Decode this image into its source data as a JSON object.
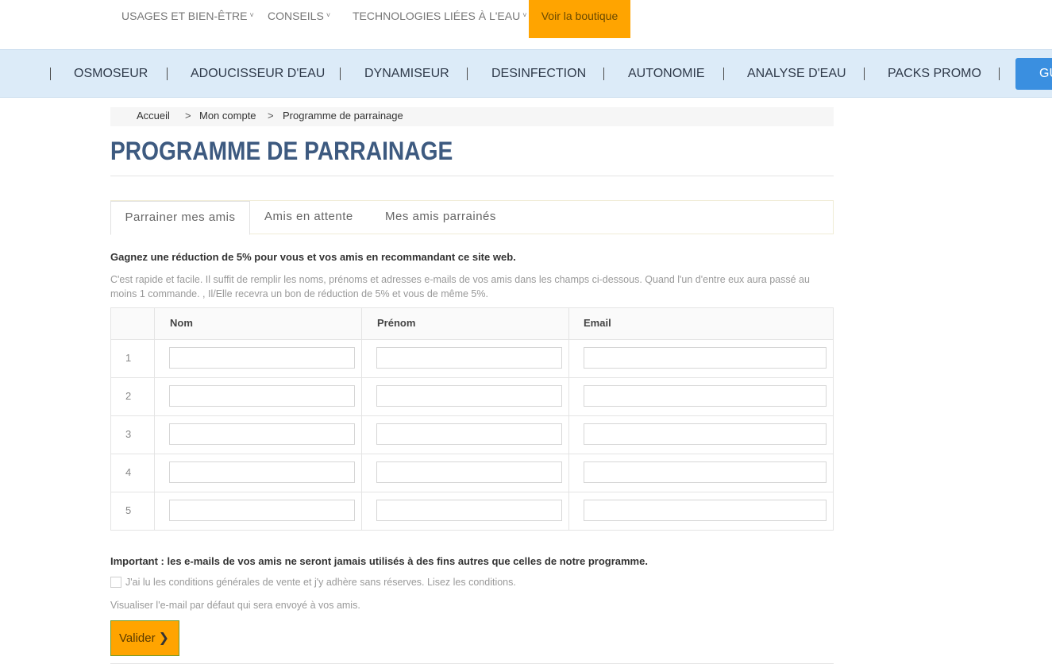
{
  "top_nav": {
    "items": [
      {
        "label": "USAGES ET BIEN-ÊTRE"
      },
      {
        "label": "CONSEILS"
      },
      {
        "label": "TECHNOLOGIES LIÉES À L'EAU"
      }
    ],
    "shop_button": "Voir la boutique",
    "chevron_icon": "chevron-down-icon"
  },
  "category_bar": {
    "items": [
      "OSMOSEUR",
      "ADOUCISSEUR D'EAU",
      "DYNAMISEUR",
      "DESINFECTION",
      "AUTONOMIE",
      "ANALYSE D'EAU",
      "PACKS PROMO"
    ],
    "cut_button": "GU"
  },
  "breadcrumb": {
    "items": [
      "Accueil",
      "Mon compte",
      "Programme de parrainage"
    ],
    "separator": ">"
  },
  "page_title": "PROGRAMME DE PARRAINAGE",
  "tabs": [
    {
      "label": "Parrainer mes amis",
      "active": true
    },
    {
      "label": "Amis en attente",
      "active": false
    },
    {
      "label": "Mes amis parrainés",
      "active": false
    }
  ],
  "intro": {
    "headline": "Gagnez une réduction de 5% pour vous et vos amis en recommandant ce site web.",
    "text": "C'est rapide et facile. Il suffit de remplir les noms, prénoms et adresses e-mails de vos amis dans les champs ci-dessous. Quand l'un d'entre eux aura passé au moins 1 commande. , Il/Elle recevra un bon de réduction de 5% et vous de même 5%."
  },
  "friends_table": {
    "columns": [
      "",
      "Nom",
      "Prénom",
      "Email"
    ],
    "rows": [
      {
        "num": "1",
        "nom": "",
        "prenom": "",
        "email": ""
      },
      {
        "num": "2",
        "nom": "",
        "prenom": "",
        "email": ""
      },
      {
        "num": "3",
        "nom": "",
        "prenom": "",
        "email": ""
      },
      {
        "num": "4",
        "nom": "",
        "prenom": "",
        "email": ""
      },
      {
        "num": "5",
        "nom": "",
        "prenom": "",
        "email": ""
      }
    ]
  },
  "important_note": "Important : les e-mails de vos amis ne seront jamais utilisés à des fins autres que celles de notre programme.",
  "cgv": {
    "label": "J'ai lu les conditions générales de vente et j'y adhère sans réserves. Lisez les conditions.",
    "checked": false
  },
  "preview_link": "Visualiser l'e-mail par défaut qui sera envoyé à vos amis.",
  "submit": {
    "label": "Valider",
    "icon": "chevron-right-icon"
  },
  "colors": {
    "accent_orange": "#ffa400",
    "title_blue": "#3d5a80",
    "category_bar_bg": "#dcebf8",
    "cta_blue": "#3a8fe0"
  }
}
